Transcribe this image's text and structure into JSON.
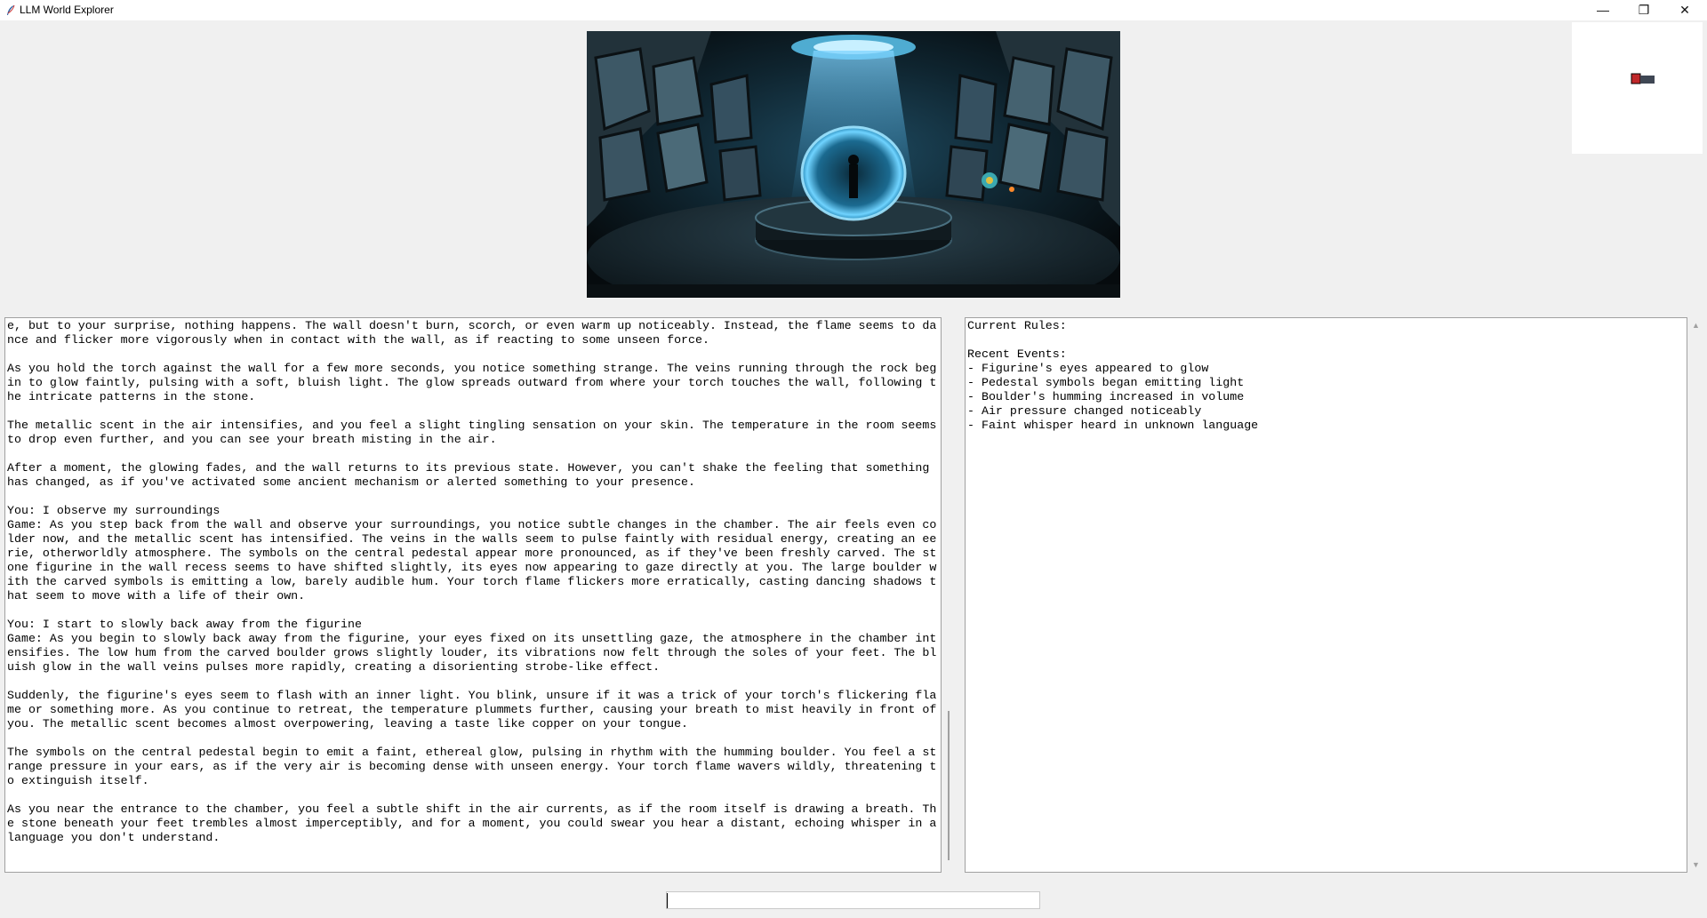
{
  "window": {
    "title": "LLM World Explorer",
    "minimize_glyph": "—",
    "restore_glyph": "❐",
    "close_glyph": "✕"
  },
  "scene_image": {
    "icon": "portal-chamber-image"
  },
  "minimap": {
    "current_room_color": "#c0282a",
    "other_room_color": "#3f4754"
  },
  "story": {
    "text": "e, but to your surprise, nothing happens. The wall doesn't burn, scorch, or even warm up noticeably. Instead, the flame seems to da\nnce and flicker more vigorously when in contact with the wall, as if reacting to some unseen force.\n\nAs you hold the torch against the wall for a few more seconds, you notice something strange. The veins running through the rock beg\nin to glow faintly, pulsing with a soft, bluish light. The glow spreads outward from where your torch touches the wall, following t\nhe intricate patterns in the stone.\n\nThe metallic scent in the air intensifies, and you feel a slight tingling sensation on your skin. The temperature in the room seems\nto drop even further, and you can see your breath misting in the air.\n\nAfter a moment, the glowing fades, and the wall returns to its previous state. However, you can't shake the feeling that something\nhas changed, as if you've activated some ancient mechanism or alerted something to your presence.\n\nYou: I observe my surroundings\nGame: As you step back from the wall and observe your surroundings, you notice subtle changes in the chamber. The air feels even co\nlder now, and the metallic scent has intensified. The veins in the walls seem to pulse faintly with residual energy, creating an ee\nrie, otherworldly atmosphere. The symbols on the central pedestal appear more pronounced, as if they've been freshly carved. The st\none figurine in the wall recess seems to have shifted slightly, its eyes now appearing to gaze directly at you. The large boulder w\nith the carved symbols is emitting a low, barely audible hum. Your torch flame flickers more erratically, casting dancing shadows t\nhat seem to move with a life of their own.\n\nYou: I start to slowly back away from the figurine\nGame: As you begin to slowly back away from the figurine, your eyes fixed on its unsettling gaze, the atmosphere in the chamber int\nensifies. The low hum from the carved boulder grows slightly louder, its vibrations now felt through the soles of your feet. The bl\nuish glow in the wall veins pulses more rapidly, creating a disorienting strobe-like effect.\n\nSuddenly, the figurine's eyes seem to flash with an inner light. You blink, unsure if it was a trick of your torch's flickering fla\nme or something more. As you continue to retreat, the temperature plummets further, causing your breath to mist heavily in front of\nyou. The metallic scent becomes almost overpowering, leaving a taste like copper on your tongue.\n\nThe symbols on the central pedestal begin to emit a faint, ethereal glow, pulsing in rhythm with the humming boulder. You feel a st\nrange pressure in your ears, as if the very air is becoming dense with unseen energy. Your torch flame wavers wildly, threatening t\no extinguish itself.\n\nAs you near the entrance to the chamber, you feel a subtle shift in the air currents, as if the room itself is drawing a breath. Th\ne stone beneath your feet trembles almost imperceptibly, and for a moment, you could swear you hear a distant, echoing whisper in a\nlanguage you don't understand."
  },
  "rules": {
    "text": "Current Rules:\n\nRecent Events:\n- Figurine's eyes appeared to glow\n- Pedestal symbols began emitting light\n- Boulder's humming increased in volume\n- Air pressure changed noticeably\n- Faint whisper heard in unknown language",
    "up_arrow": "▲",
    "down_arrow": "▼"
  },
  "command_input": {
    "value": "",
    "placeholder": ""
  }
}
